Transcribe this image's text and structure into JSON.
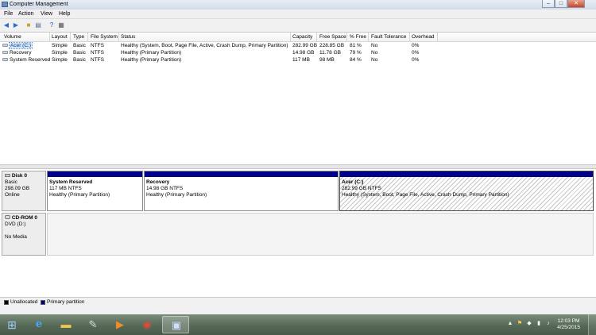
{
  "window": {
    "title": "Computer Management",
    "controls": {
      "minimize": "–",
      "maximize": "□",
      "close": "✕"
    }
  },
  "menu": [
    "File",
    "Action",
    "View",
    "Help"
  ],
  "toolbar": {
    "icons": [
      "back-arrow",
      "forward-arrow",
      "up-folder",
      "console-tree",
      "help",
      "properties"
    ]
  },
  "volume_list": {
    "columns": [
      "Volume",
      "Layout",
      "Type",
      "File System",
      "Status",
      "Capacity",
      "Free Space",
      "% Free",
      "Fault Tolerance",
      "Overhead"
    ],
    "rows": [
      {
        "volume": "Acer (C:)",
        "layout": "Simple",
        "type": "Basic",
        "fs": "NTFS",
        "status": "Healthy (System, Boot, Page File, Active, Crash Dump, Primary Partition)",
        "capacity": "282.99 GB",
        "free": "228.85 GB",
        "pct": "81 %",
        "fault": "No",
        "overhead": "0%"
      },
      {
        "volume": "Recovery",
        "layout": "Simple",
        "type": "Basic",
        "fs": "NTFS",
        "status": "Healthy (Primary Partition)",
        "capacity": "14.98 GB",
        "free": "11.78 GB",
        "pct": "79 %",
        "fault": "No",
        "overhead": "0%"
      },
      {
        "volume": "System Reserved",
        "layout": "Simple",
        "type": "Basic",
        "fs": "NTFS",
        "status": "Healthy (Primary Partition)",
        "capacity": "117 MB",
        "free": "98 MB",
        "pct": "84 %",
        "fault": "No",
        "overhead": "0%"
      }
    ]
  },
  "disks": [
    {
      "name": "Disk 0",
      "kind": "Basic",
      "size": "298.09 GB",
      "state": "Online",
      "partitions": [
        {
          "name": "System Reserved",
          "size": "117 MB NTFS",
          "status": "Healthy (Primary Partition)"
        },
        {
          "name": "Recovery",
          "size": "14.98 GB NTFS",
          "status": "Healthy (Primary Partition)"
        },
        {
          "name": "Acer  (C:)",
          "size": "282.99 GB NTFS",
          "status": "Healthy (System, Boot, Page File, Active, Crash Dump, Primary Partition)"
        }
      ]
    },
    {
      "name": "CD-ROM 0",
      "kind": "DVD (D:)",
      "media": "No Media"
    }
  ],
  "legend": [
    {
      "label": "Unallocated",
      "color": "#000000"
    },
    {
      "label": "Primary partition",
      "color": "#00008b"
    }
  ],
  "colors": {
    "partition_bar": "#00008b",
    "selection": "#cde4fb"
  },
  "taskbar": {
    "apps": [
      "start-orb",
      "internet-explorer",
      "file-explorer",
      "tools",
      "media-player",
      "chrome",
      "computer-management"
    ],
    "clock": {
      "time": "12:03 PM",
      "date": "4/25/2015"
    }
  }
}
